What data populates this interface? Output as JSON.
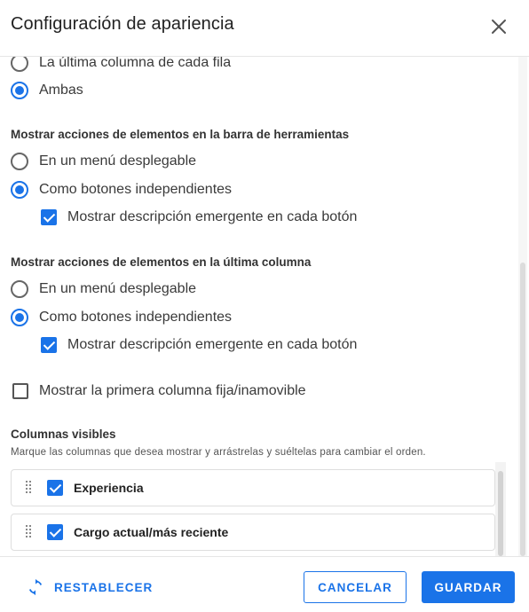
{
  "dialog": {
    "title": "Configuración de apariencia",
    "close_icon": "close-icon"
  },
  "row_actions_position": {
    "options": [
      {
        "label": "La última columna de cada fila",
        "selected": false
      },
      {
        "label": "Ambas",
        "selected": true
      }
    ]
  },
  "toolbar_actions": {
    "heading": "Mostrar acciones de elementos en la barra de herramientas",
    "options": [
      {
        "label": "En un menú desplegable",
        "selected": false
      },
      {
        "label": "Como botones independientes",
        "selected": true
      }
    ],
    "tooltip_checkbox": {
      "label": "Mostrar descripción emergente en cada botón",
      "checked": true
    }
  },
  "last_column_actions": {
    "heading": "Mostrar acciones de elementos en la última columna",
    "options": [
      {
        "label": "En un menú desplegable",
        "selected": false
      },
      {
        "label": "Como botones independientes",
        "selected": true
      }
    ],
    "tooltip_checkbox": {
      "label": "Mostrar descripción emergente en cada botón",
      "checked": true
    }
  },
  "fixed_first_column": {
    "label": "Mostrar la primera columna fija/inamovible",
    "checked": false
  },
  "visible_columns": {
    "heading": "Columnas visibles",
    "description": "Marque las columnas que desea mostrar y arrástrelas y suéltelas para cambiar el orden.",
    "items": [
      {
        "label": "Experiencia",
        "checked": true
      },
      {
        "label": "Cargo actual/más reciente",
        "checked": true
      }
    ]
  },
  "footer": {
    "reset_label": "RESTABLECER",
    "cancel_label": "CANCELAR",
    "save_label": "GUARDAR"
  },
  "colors": {
    "accent": "#1a73e8"
  }
}
